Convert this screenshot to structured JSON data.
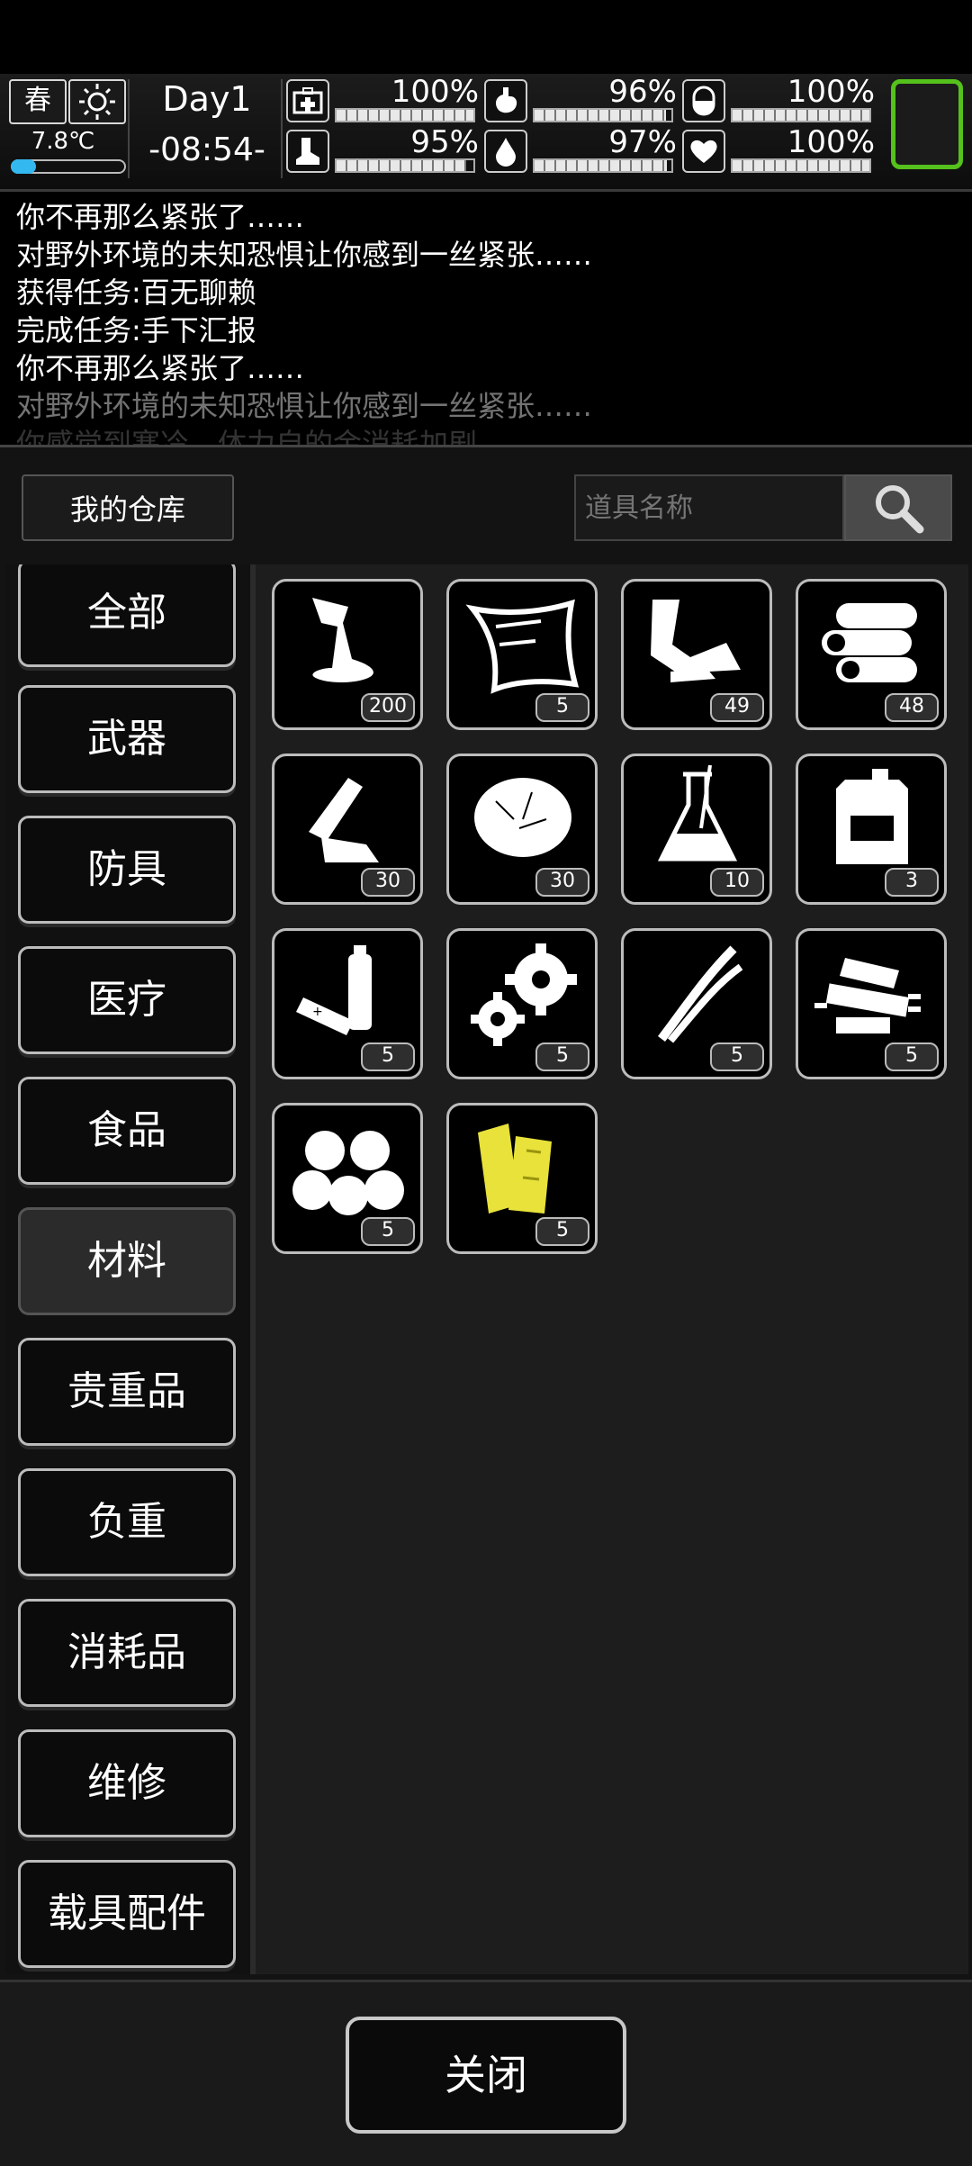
{
  "hud": {
    "season": "春",
    "weather_icon": "sun-icon",
    "temperature": "7.8℃",
    "temperature_level": 0.22,
    "day": "Day1",
    "time": "-08:54-",
    "stats": [
      {
        "name": "health",
        "icon": "medkit-icon",
        "value": "100%",
        "level": 1.0
      },
      {
        "name": "stamina",
        "icon": "boot-icon",
        "value": "95%",
        "level": 0.95
      },
      {
        "name": "hunger",
        "icon": "stomach-icon",
        "value": "96%",
        "level": 0.96
      },
      {
        "name": "thirst",
        "icon": "water-drop-icon",
        "value": "97%",
        "level": 0.97
      },
      {
        "name": "immunity",
        "icon": "pill-icon",
        "value": "100%",
        "level": 1.0
      },
      {
        "name": "mood",
        "icon": "heart-icon",
        "value": "100%",
        "level": 1.0
      }
    ],
    "accent_color": "#55c11c"
  },
  "log": [
    "你不再那么紧张了……",
    "对野外环境的未知恐惧让你感到一丝紧张……",
    "获得任务:百无聊赖",
    "完成任务:手下汇报",
    "你不再那么紧张了……",
    "对野外环境的未知恐惧让你感到一丝紧张……",
    "你感觉到寒冷，体力自的金消耗加剧"
  ],
  "warehouse": {
    "title": "我的仓库",
    "search_placeholder": "道具名称",
    "categories": [
      "全部",
      "武器",
      "防具",
      "医疗",
      "食品",
      "材料",
      "贵重品",
      "负重",
      "消耗品",
      "维修",
      "载具配件"
    ],
    "selected_category": "材料",
    "items": [
      {
        "icon": "glue-icon",
        "count": "200"
      },
      {
        "icon": "plastic-sheet-icon",
        "count": "5"
      },
      {
        "icon": "scrap-fabric-icon",
        "count": "49"
      },
      {
        "icon": "cloth-roll-icon",
        "count": "48"
      },
      {
        "icon": "plastic-bottle-icon",
        "count": "30"
      },
      {
        "icon": "cotton-fiber-icon",
        "count": "30"
      },
      {
        "icon": "flask-icon",
        "count": "10"
      },
      {
        "icon": "jerrycan-icon",
        "count": "3"
      },
      {
        "icon": "battery-icon",
        "count": "5"
      },
      {
        "icon": "gear-icon",
        "count": "5"
      },
      {
        "icon": "wire-icon",
        "count": "5"
      },
      {
        "icon": "electronic-parts-icon",
        "count": "5"
      },
      {
        "icon": "cotton-balls-icon",
        "count": "5"
      },
      {
        "icon": "wood-planks-icon",
        "count": "5"
      }
    ],
    "close_label": "关闭"
  }
}
